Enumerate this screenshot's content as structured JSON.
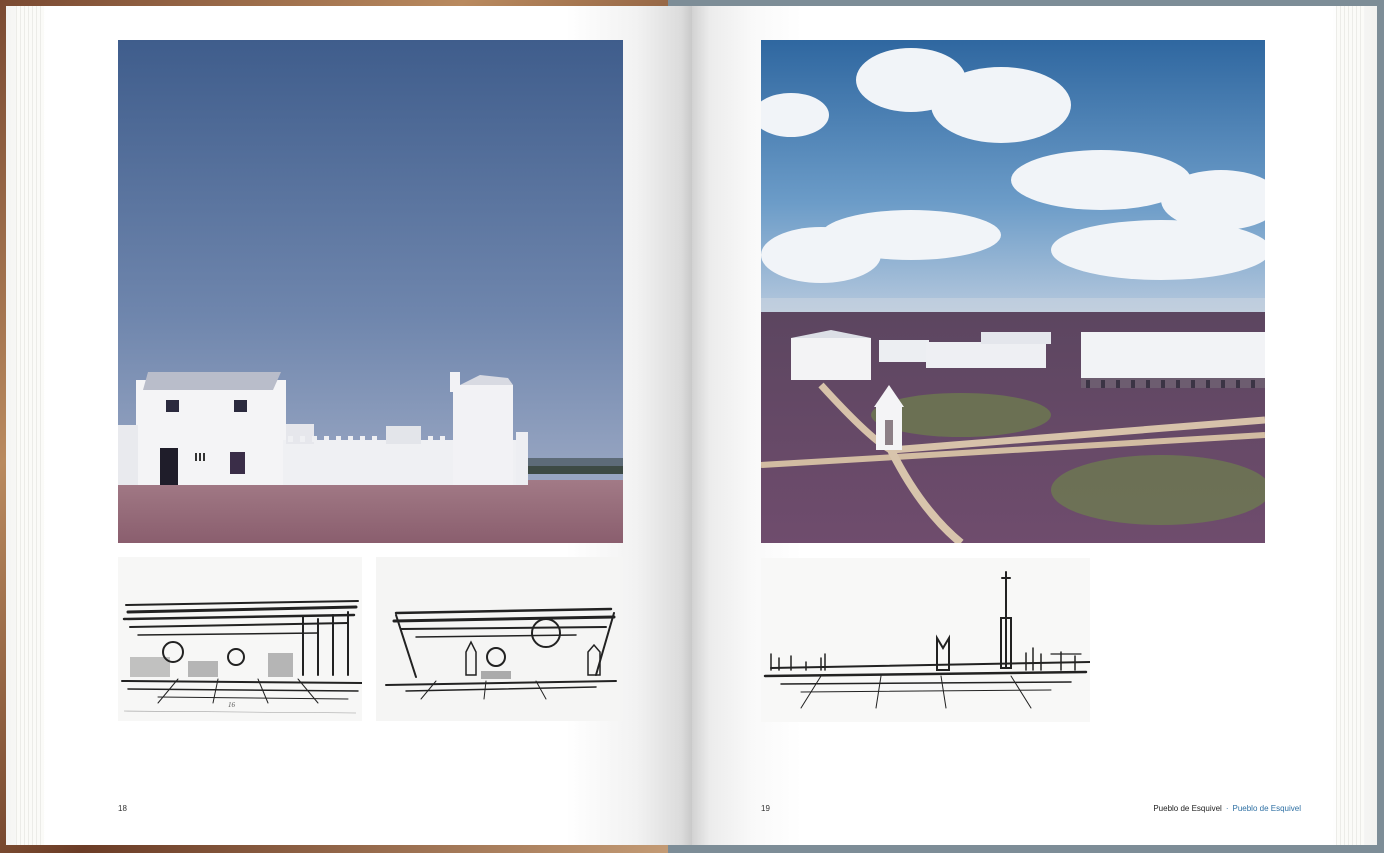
{
  "book": {
    "left_page_number": "18",
    "right_page_number": "19",
    "running_head": {
      "title": "Pueblo de Esquivel",
      "separator": "·",
      "title_accent": "Pueblo de Esquivel"
    }
  },
  "colors": {
    "accent": "#2d6fa3",
    "page": "#ffffff",
    "text": "#222222"
  },
  "images": {
    "left_main": "whitewashed-houses-photo",
    "right_main": "village-aerial-photo",
    "sketch_1": "plaza-sketch",
    "sketch_2": "street-sketch",
    "sketch_3": "skyline-sketch",
    "sketch_1_annotation": "16"
  }
}
